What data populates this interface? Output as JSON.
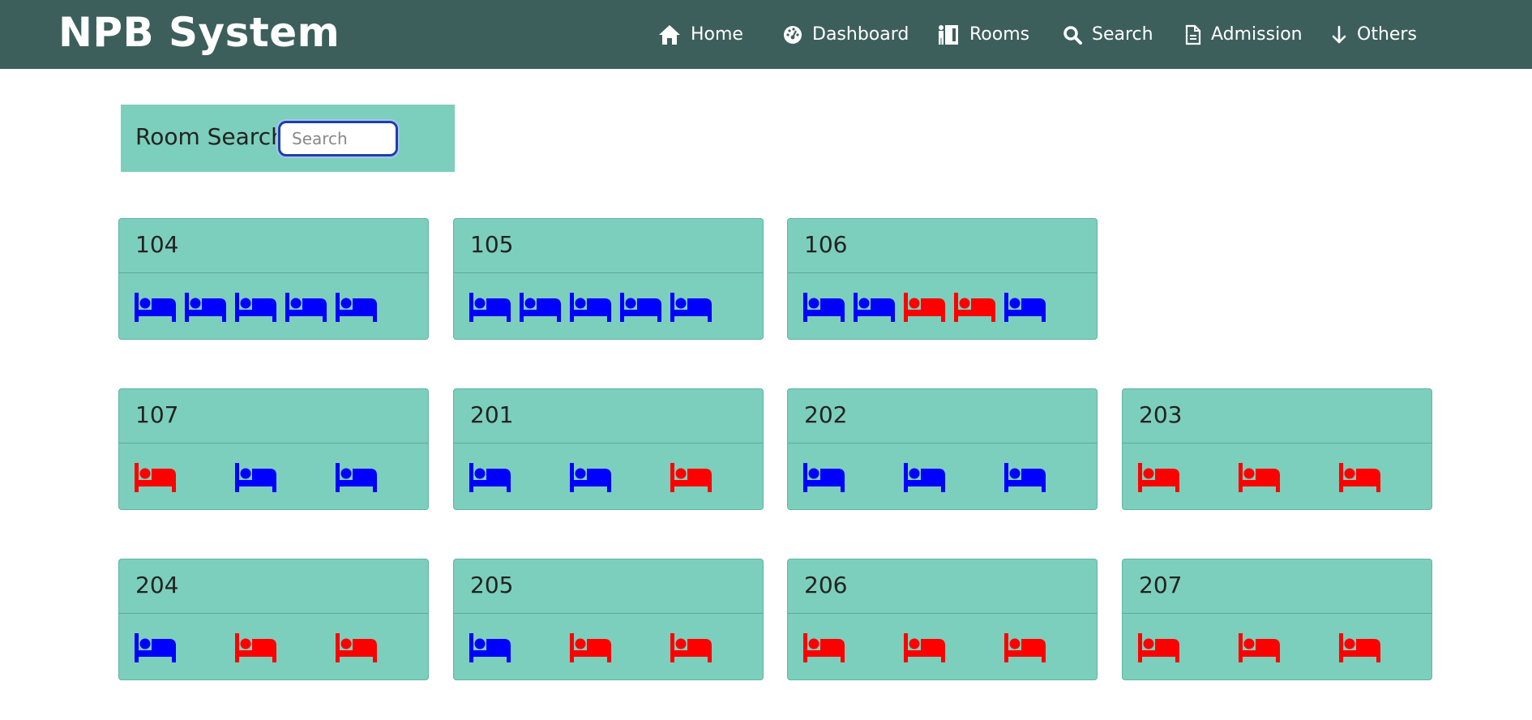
{
  "brand": "NPB System",
  "nav": [
    {
      "label": "Home",
      "icon": "home-icon"
    },
    {
      "label": "Dashboard",
      "icon": "dashboard-icon"
    },
    {
      "label": "Rooms",
      "icon": "rooms-icon"
    },
    {
      "label": "Search",
      "icon": "search-icon"
    },
    {
      "label": "Admission",
      "icon": "document-icon"
    },
    {
      "label": "Others",
      "icon": "arrow-down-icon"
    }
  ],
  "search": {
    "label": "Room Search",
    "placeholder": "Search",
    "value": ""
  },
  "colors": {
    "vacant": "#0000ff",
    "occupied": "#ff0000",
    "navbar": "#3d5f5c",
    "card": "#7ccfbc"
  },
  "rooms": [
    {
      "number": "104",
      "beds": [
        "vacant",
        "vacant",
        "vacant",
        "vacant",
        "vacant"
      ]
    },
    {
      "number": "105",
      "beds": [
        "vacant",
        "vacant",
        "vacant",
        "vacant",
        "vacant"
      ]
    },
    {
      "number": "106",
      "beds": [
        "vacant",
        "vacant",
        "occupied",
        "occupied",
        "vacant"
      ]
    },
    {
      "number": "107",
      "beds": [
        "occupied",
        "vacant",
        "vacant"
      ]
    },
    {
      "number": "201",
      "beds": [
        "vacant",
        "vacant",
        "occupied"
      ]
    },
    {
      "number": "202",
      "beds": [
        "vacant",
        "vacant",
        "vacant"
      ]
    },
    {
      "number": "203",
      "beds": [
        "occupied",
        "occupied",
        "occupied"
      ]
    },
    {
      "number": "204",
      "beds": [
        "vacant",
        "occupied",
        "occupied"
      ]
    },
    {
      "number": "205",
      "beds": [
        "vacant",
        "occupied",
        "occupied"
      ]
    },
    {
      "number": "206",
      "beds": [
        "occupied",
        "occupied",
        "occupied"
      ]
    },
    {
      "number": "207",
      "beds": [
        "occupied",
        "occupied",
        "occupied"
      ]
    }
  ]
}
